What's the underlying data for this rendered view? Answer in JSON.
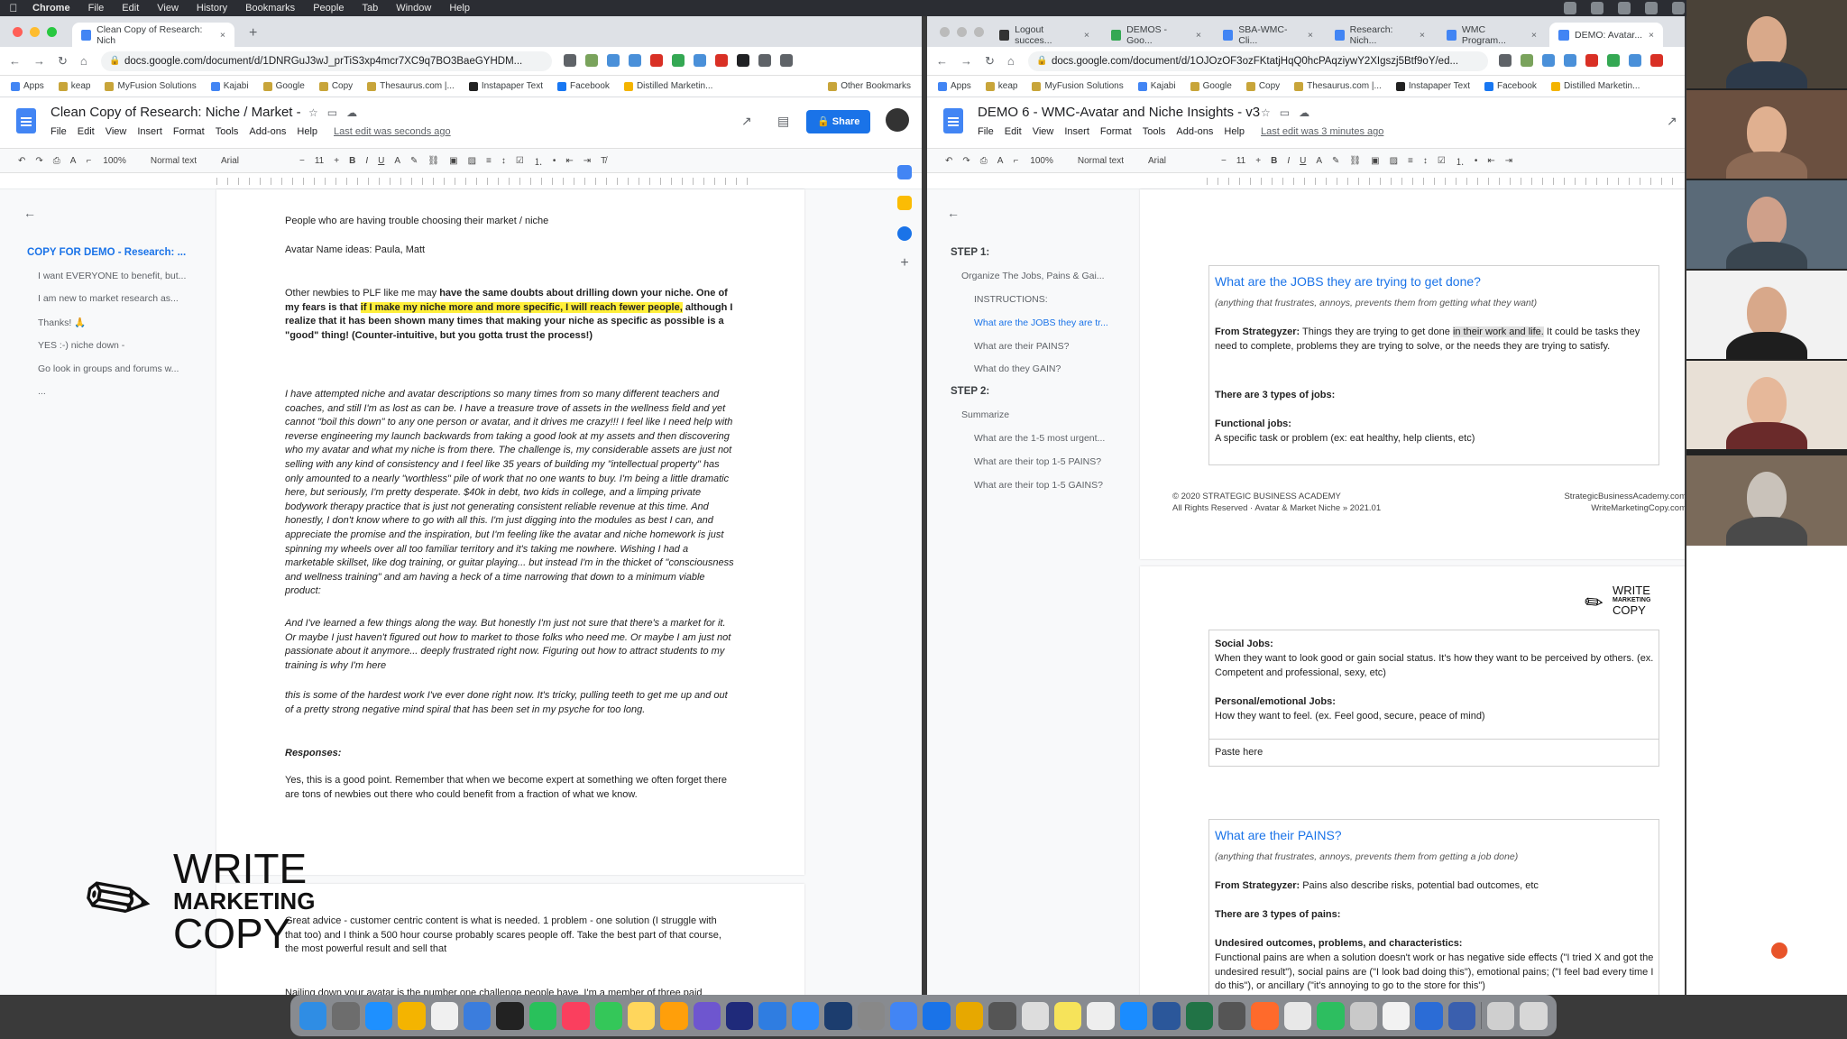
{
  "menubar": {
    "app": "Chrome",
    "items": [
      "File",
      "Edit",
      "View",
      "History",
      "Bookmarks",
      "People",
      "Tab",
      "Window",
      "Help"
    ]
  },
  "left": {
    "tab_title": "Clean Copy of Research: Nich",
    "url": "docs.google.com/document/d/1DNRGuJ3wJ_prTiS3xp4mcr7XC9q7BO3BaeGYHDM...",
    "bookmarks": [
      "Apps",
      "keap",
      "MyFusion Solutions",
      "Kajabi",
      "Google",
      "Copy",
      "Thesaurus.com |...",
      "Instapaper Text",
      "Facebook",
      "Distilled Marketin..."
    ],
    "other_bookmarks": "Other Bookmarks",
    "doc_title": "Clean Copy of Research: Niche / Market -",
    "menus": [
      "File",
      "Edit",
      "View",
      "Insert",
      "Format",
      "Tools",
      "Add-ons",
      "Help"
    ],
    "last_edit": "Last edit was seconds ago",
    "share": "Share",
    "toolbar": {
      "zoom": "100%",
      "style": "Normal text",
      "font": "Arial",
      "size": "11"
    },
    "outline": {
      "heading": "COPY FOR DEMO - Research: ...",
      "items": [
        "I want EVERYONE to benefit, but...",
        "I am new to market research as...",
        "Thanks! 🙏",
        "YES :-) niche down -",
        "Go look in groups and forums w...",
        "..."
      ]
    },
    "page": {
      "line1": "People who are having trouble choosing their market / niche",
      "line2": "Avatar Name ideas:  Paula, Matt",
      "p3_a": "Other newbies to PLF like me may ",
      "p3_b": "have the same doubts about drilling down your niche. One of my fears is that ",
      "p3_hl1": "if I make my niche more and more specific, I will reach fewer people,",
      "p3_c": " although I realize that it has been shown many times that making your niche as specific as possible is a \"good\" thing! (Counter-intuitive, but you gotta trust the process!)",
      "p4": "I have attempted niche and avatar descriptions so many times from so many different teachers and coaches, and still I'm as lost as can be. I have a treasure trove of assets in the wellness field and yet cannot \"boil this down\" to any one person or avatar, and it drives me crazy!!! I feel like I need help with reverse engineering my launch backwards from taking a good look at my assets and then discovering who my avatar and what my niche is from there. The challenge is, my considerable assets are just not selling with any kind of consistency and I feel like 35 years of building my \"intellectual property\" has only amounted to a nearly \"worthless\" pile of work that no one wants to buy. I'm being a little dramatic here, but seriously, I'm pretty desperate. $40k in debt, two kids in college, and a limping private bodywork therapy practice that is just not generating consistent reliable revenue at this time. And honestly, I don't know where to go with all this. I'm just digging into the modules as best I can, and appreciate the promise and the inspiration, but I'm feeling like the avatar and niche homework is just spinning my wheels over all too familiar territory and it's taking me nowhere. Wishing I had a marketable skillset, like dog training, or guitar playing... but instead I'm in the thicket of \"consciousness and wellness training\" and am having a heck of a time narrowing that down to a minimum viable product:",
      "p5": "And I've learned a few things along the way. But honestly I'm just not sure that there's a market for it. Or maybe I just haven't figured out how to market to those folks who need me. Or maybe I am just not passionate about it anymore... deeply frustrated right now.  Figuring out how  to attract students to my training is why I'm here",
      "p6": "this is some of the hardest work I've ever done right now. It's tricky, pulling teeth to get me up and out of a pretty strong negative mind spiral that has been set in my psyche for too long.",
      "responses": "Responses:",
      "p7": "Yes, this is a good point. Remember that when we become expert at something we often forget there are tons of newbies out there who could benefit from a fraction of what we know.",
      "p8": "Great advice - customer centric content is what is needed. 1 problem - one solution (I struggle with that too) and I think a 500 hour course probably scares people off. Take the best part of that course, the most powerful result and sell that",
      "p9": "Nailing down your avatar is the number one challenge people have. I'm a member of three paid"
    }
  },
  "right": {
    "tabs": [
      "Logout succes...",
      "DEMOS - Goo...",
      "SBA-WMC-Cli...",
      "Research: Nich...",
      "WMC Program...",
      "DEMO: Avatar..."
    ],
    "url": "docs.google.com/document/d/1OJOzOF3ozFKtatjHqQ0hcPAqziywY2XIgszj5Btf9oY/ed...",
    "bookmarks": [
      "Apps",
      "keap",
      "MyFusion Solutions",
      "Kajabi",
      "Google",
      "Copy",
      "Thesaurus.com |...",
      "Instapaper Text",
      "Facebook",
      "Distilled Marketin..."
    ],
    "doc_title": "DEMO 6 - WMC-Avatar and Niche Insights - v3",
    "menus": [
      "File",
      "Edit",
      "View",
      "Insert",
      "Format",
      "Tools",
      "Add-ons",
      "Help"
    ],
    "last_edit": "Last edit was 3 minutes ago",
    "toolbar": {
      "zoom": "100%",
      "style": "Normal text",
      "font": "Arial",
      "size": "11"
    },
    "outline": {
      "step1": "STEP 1:",
      "s1_items": [
        "Organize The Jobs, Pains & Gai...",
        "INSTRUCTIONS:",
        "What are the JOBS they are tr...",
        "What are their PAINS?",
        "What do they GAIN?"
      ],
      "step2": "STEP 2:",
      "s2_items": [
        "Summarize",
        "What are the 1-5 most urgent...",
        "What are their top 1-5 PAINS?",
        "What are their top 1-5 GAINS?"
      ]
    },
    "page": {
      "jobs_h": "What are the JOBS they are trying to get done?",
      "jobs_sub": "(anything that frustrates, annoys, prevents them from getting what they want)",
      "strat_label": "From Strategyzer:",
      "strat_text_a": "  Things they are trying to get done ",
      "strat_hl": "in their work and life.",
      "strat_text_b": " It could be tasks they need to complete, problems they are trying to solve, or the needs they are trying to satisfy.",
      "three_types": "There are 3 types of jobs:",
      "functional_h": "Functional jobs:",
      "functional_t": "A specific task or problem (ex:  eat healthy, help clients, etc)",
      "footer_l1": "© 2020 STRATEGIC BUSINESS ACADEMY",
      "footer_l2": "All Rights Reserved  · Avatar & Market Niche » 2021.01",
      "footer_r1": "StrategicBusinessAcademy.com",
      "footer_r2": "WriteMarketingCopy.com",
      "social_h": "Social Jobs:",
      "social_t": "When they want to look good or gain social status. It's how they want to be perceived by others. (ex. Competent and professional, sexy, etc)",
      "personal_h": "Personal/emotional Jobs:",
      "personal_t": "How they want to feel. (ex. Feel good, secure, peace of mind)",
      "paste": "Paste here",
      "pains_h": "What are their PAINS?",
      "pains_sub": "(anything that frustrates, annoys, prevents them from getting a job done)",
      "pains_strat": "  Pains also describe risks, potential bad outcomes, etc",
      "pains_types": "There are 3 types of pains:",
      "undesired_h": "Undesired outcomes, problems, and characteristics:",
      "undesired_t": "Functional pains are when a solution doesn't work or has negative side effects (\"I tried X and got the undesired result\"), social pains are (\"I look bad doing this\"), emotional pains; (\"I feel bad every time I do this\"), or ancillary (\"it's annoying to go to the store for this\")"
    },
    "logo": {
      "line1": "WRITE",
      "line2": "MARKETING",
      "line3": "COPY"
    }
  },
  "watermark": {
    "line1": "WRITE",
    "line2": "MARKETING",
    "line3": "COPY"
  }
}
